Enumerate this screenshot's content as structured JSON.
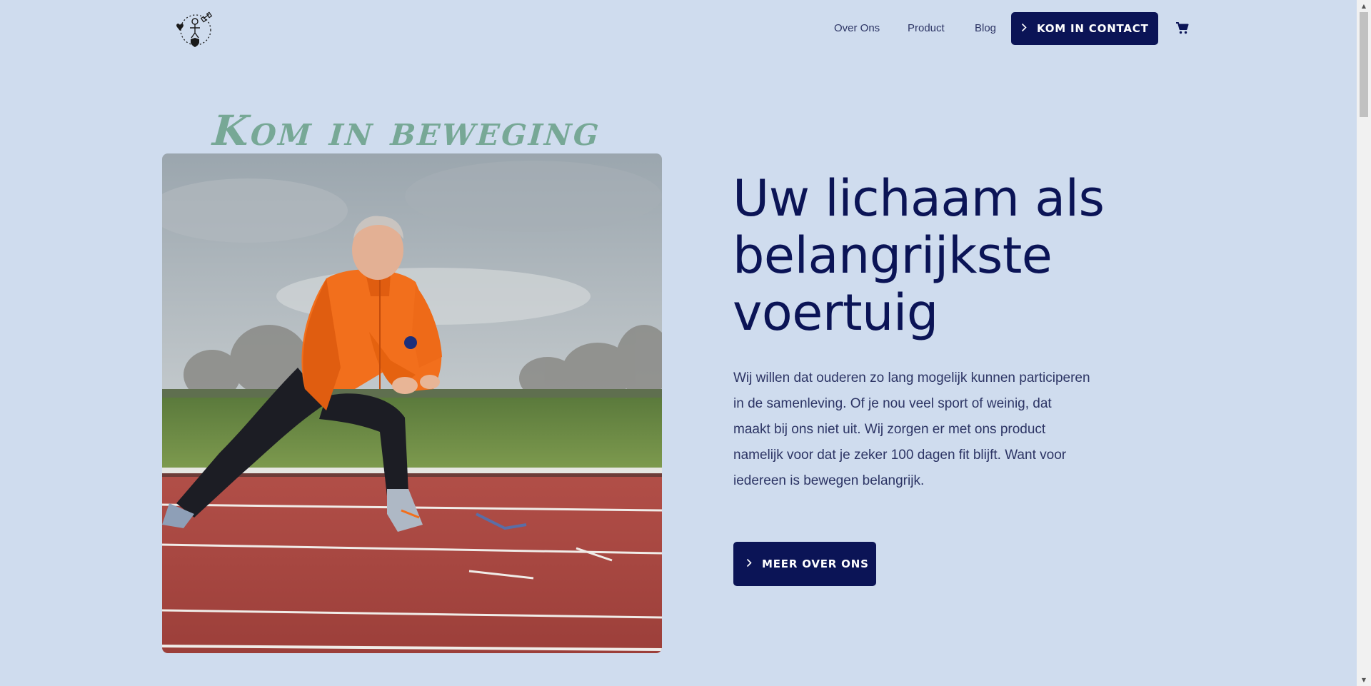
{
  "nav": {
    "logo_icon": "heart-person-hand-logo",
    "links": [
      "Over Ons",
      "Product",
      "Blog"
    ],
    "contact_label": "KOM IN CONTACT",
    "cart_icon": "cart-icon"
  },
  "hero": {
    "tagline": "Kom in beweging",
    "heading": "Uw lichaam als belangrijkste voertuig",
    "intro": "Wij willen dat ouderen zo lang mogelijk kunnen participeren in de samenleving. Of je nou veel sport of weinig, dat maakt bij ons niet uit. Wij zorgen er met ons product namelijk voor dat je zeker 100 dagen fit blijft. Want voor iedereen is bewegen belangrijk.",
    "cta_label": "MEER OVER ONS"
  },
  "colors": {
    "background": "#cfdcee",
    "navy": "#0b1456",
    "tagline_green": "#77a896",
    "track_red": "#a94844",
    "jacket_orange": "#f26f1c"
  }
}
